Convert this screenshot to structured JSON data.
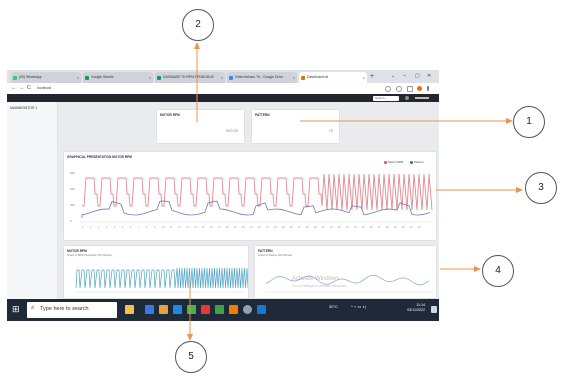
{
  "browser": {
    "tabs": [
      {
        "label": "(53) WhatsApp",
        "color": "#25d366"
      },
      {
        "label": "Google Sheets",
        "color": "#0f9d58"
      },
      {
        "label": "DATABASE Tb RPM PENDUDUK",
        "color": "#0f9d58"
      },
      {
        "label": "Video terbaru Tb - Google Drive",
        "color": "#4285f4"
      },
      {
        "label": "Dashboard v6",
        "color": "#e37400"
      }
    ],
    "new_tab_label": "+",
    "window_controls": [
      "⌄",
      "–",
      "▢",
      "✕"
    ],
    "nav": [
      "←",
      "→",
      "C"
    ],
    "url": "localhost"
  },
  "app": {
    "search_placeholder": "Search...",
    "sidebar_item": "MAINMONITOR 1"
  },
  "cards": {
    "motor_rpm": {
      "title": "MOTOR RPM",
      "value": "900.00"
    },
    "pattern": {
      "title": "PATTERN",
      "value": "75"
    }
  },
  "main_chart": {
    "title": "GRAPHICAL PRESENTATION MOTOR RPM",
    "legend": [
      {
        "label": "Motor RPM",
        "color": "#d9534f"
      },
      {
        "label": "Pattern",
        "color": "#555e9b"
      }
    ]
  },
  "small_charts": {
    "left": {
      "title": "MOTOR RPM",
      "subtitle": "Graph of RPM Fluctuation (Per Minute)",
      "color": "#4fa3c7"
    },
    "right": {
      "title": "PATTERN",
      "subtitle": "Graph of Pattern (Per Minute)",
      "color": "#8aa4cf"
    }
  },
  "watermark": {
    "title": "Activate Windows",
    "sub": "Go to Settings to activate Windows."
  },
  "taskbar": {
    "search_label": "Type here to search",
    "weather": "30°C",
    "time": "11:14",
    "date": "03/11/2022"
  },
  "callouts": [
    "1",
    "2",
    "3",
    "4",
    "5"
  ]
}
